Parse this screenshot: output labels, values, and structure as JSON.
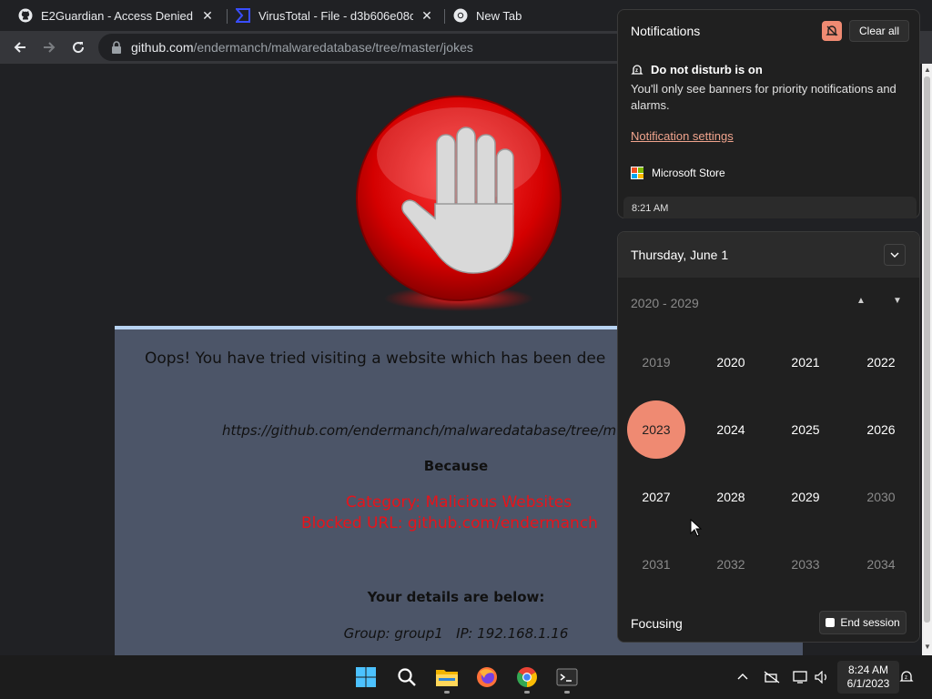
{
  "browser": {
    "tabs": [
      {
        "title": "E2Guardian - Access Denied",
        "icon": "github-icon"
      },
      {
        "title": "VirusTotal - File - d3b606e08c52…",
        "icon": "virustotal-icon"
      },
      {
        "title": "New Tab",
        "icon": "chrome-icon"
      }
    ],
    "url_host": "github.com",
    "url_path": "/endermanch/malwaredatabase/tree/master/jokes"
  },
  "page": {
    "heading": "Oops! You have tried visiting a website which has been dee",
    "blocked_url": "https://github.com/endermanch/malwaredatabase/tree/m",
    "because": "Because",
    "category": "Category: Malicious Websites",
    "blocked_line": "Blocked URL: github.com/endermanch",
    "details_heading": "Your details are below:",
    "group_ip": "Group: group1   IP: 192.168.1.16"
  },
  "notifications": {
    "title": "Notifications",
    "clear_all": "Clear all",
    "dnd_title": "Do not disturb is on",
    "dnd_desc": "You'll only see banners for priority notifications and alarms.",
    "settings_link": "Notification settings",
    "app": "Microsoft Store",
    "time": "8:21 AM"
  },
  "calendar": {
    "date": "Thursday, June 1",
    "decade": "2020 - 2029",
    "years": [
      {
        "label": "2019",
        "state": "dim"
      },
      {
        "label": "2020",
        "state": "normal"
      },
      {
        "label": "2021",
        "state": "normal"
      },
      {
        "label": "2022",
        "state": "normal"
      },
      {
        "label": "2023",
        "state": "selected"
      },
      {
        "label": "2024",
        "state": "normal"
      },
      {
        "label": "2025",
        "state": "normal"
      },
      {
        "label": "2026",
        "state": "normal"
      },
      {
        "label": "2027",
        "state": "normal"
      },
      {
        "label": "2028",
        "state": "normal"
      },
      {
        "label": "2029",
        "state": "normal"
      },
      {
        "label": "2030",
        "state": "dim"
      },
      {
        "label": "2031",
        "state": "dim"
      },
      {
        "label": "2032",
        "state": "dim"
      },
      {
        "label": "2033",
        "state": "dim"
      },
      {
        "label": "2034",
        "state": "dim"
      }
    ],
    "focus_label": "Focusing",
    "end_session": "End session"
  },
  "taskbar": {
    "apps": [
      "start-icon",
      "search-icon",
      "file-explorer-icon",
      "firefox-icon",
      "chrome-icon",
      "terminal-icon"
    ],
    "time": "8:24 AM",
    "date": "6/1/2023"
  },
  "colors": {
    "accent": "#ef8a72",
    "blocked_text": "#e8131a",
    "panel_bg": "#4c5568"
  }
}
